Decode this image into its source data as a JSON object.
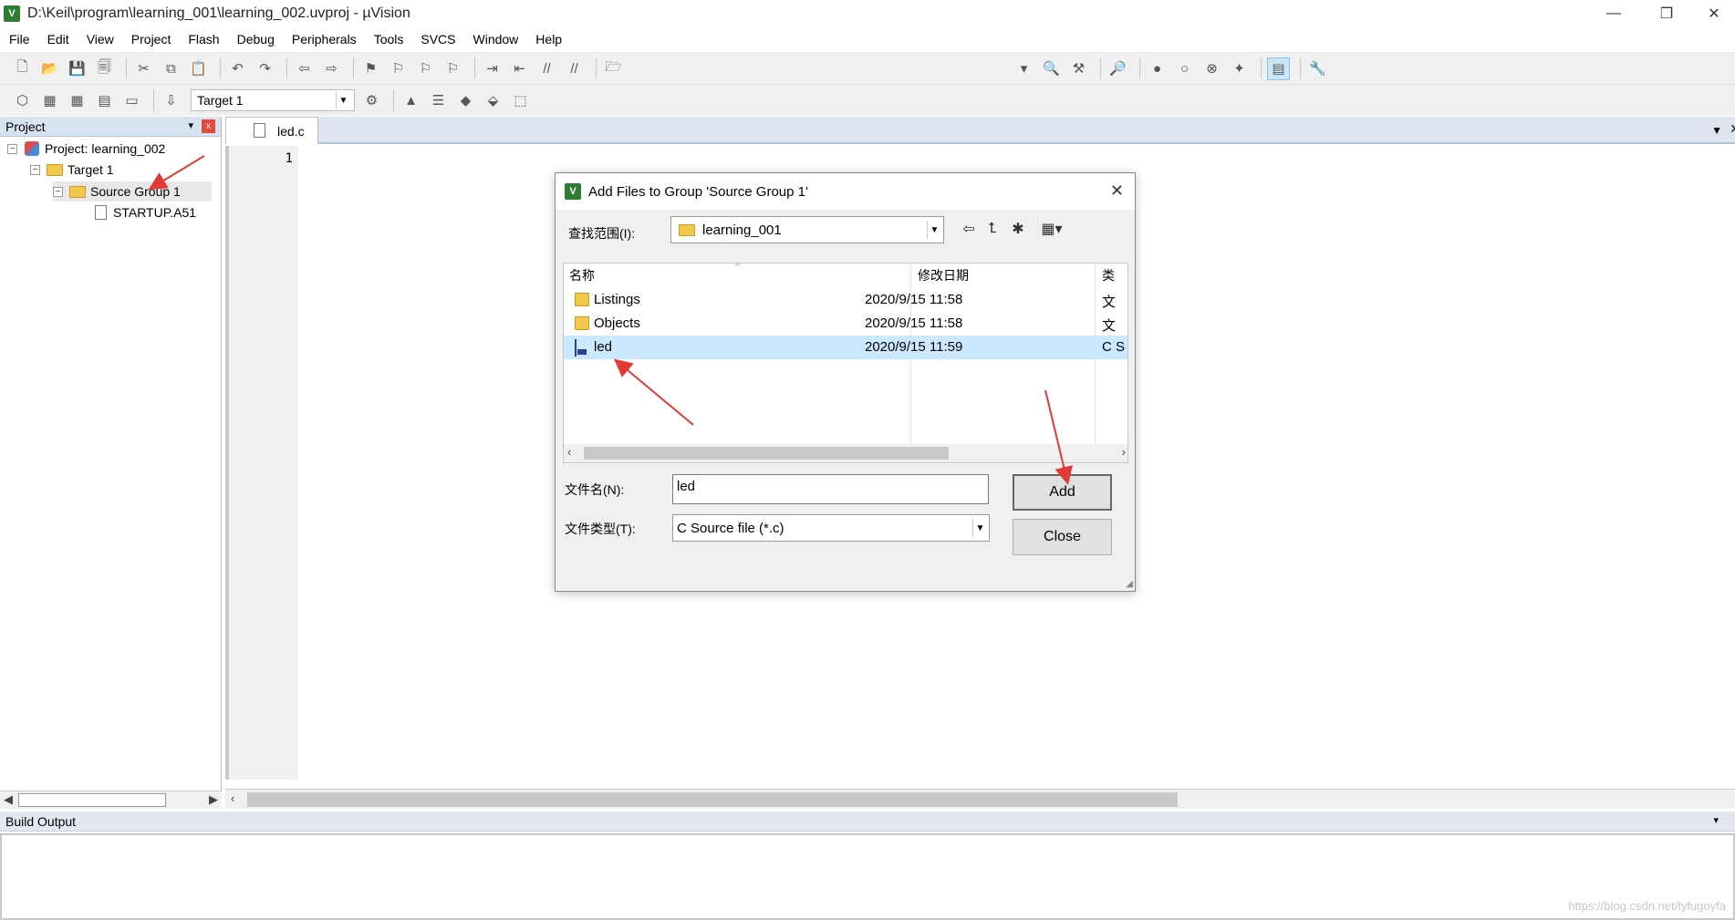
{
  "window": {
    "title": "D:\\Keil\\program\\learning_001\\learning_002.uvproj - µVision",
    "app_icon": "V",
    "minimize": "—",
    "restore": "❐",
    "close": "✕"
  },
  "menu": [
    "File",
    "Edit",
    "View",
    "Project",
    "Flash",
    "Debug",
    "Peripherals",
    "Tools",
    "SVCS",
    "Window",
    "Help"
  ],
  "toolbar2": {
    "target": "Target 1"
  },
  "project_panel": {
    "title": "Project",
    "pin": "📌",
    "close": "x",
    "tree": {
      "project": "Project: learning_002",
      "target": "Target 1",
      "group": "Source Group 1",
      "file": "STARTUP.A51"
    }
  },
  "editor": {
    "tab": "led.c",
    "line_numbers": [
      "1"
    ]
  },
  "build_output": {
    "title": "Build Output",
    "watermark": "https://blog.csdn.net/fyfugoyfa"
  },
  "dialog": {
    "title": "Add Files to Group 'Source Group 1'",
    "look_in_label": "查找范围(I):",
    "look_in_value": "learning_001",
    "columns": [
      "名称",
      "修改日期",
      "类"
    ],
    "files": [
      {
        "name": "Listings",
        "date": "2020/9/15 11:58",
        "type": "文"
      },
      {
        "name": "Objects",
        "date": "2020/9/15 11:58",
        "type": "文"
      },
      {
        "name": "led",
        "date": "2020/9/15 11:59",
        "type": "C S"
      }
    ],
    "filename_label": "文件名(N):",
    "filename_value": "led",
    "filetype_label": "文件类型(T):",
    "filetype_value": "C Source file (*.c)",
    "add_label": "Add",
    "close_label": "Close"
  },
  "colors": {
    "annotation_arrow": "#e53935",
    "selection": "#cce8ff",
    "panel_header": "#d7e3f1"
  }
}
